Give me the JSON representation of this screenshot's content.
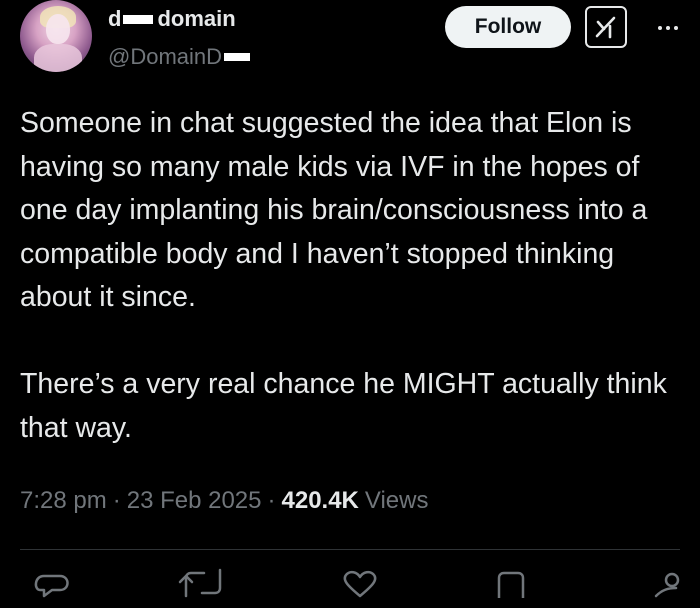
{
  "author": {
    "display_name_start": "d",
    "display_name_rest": "domain",
    "handle": "@DomainD"
  },
  "header": {
    "follow_label": "Follow",
    "grok_icon": "grok-icon",
    "more_icon": "more-icon"
  },
  "tweet": {
    "paragraphs": [
      "Someone in chat suggested the idea that Elon is having so many male kids via IVF in the hopes of one day implanting his brain/consciousness into a compatible body and I haven’t stopped thinking about it since.",
      "There’s a very real chance he MIGHT actually think that way."
    ]
  },
  "meta": {
    "time": "7:28 pm",
    "date": "23 Feb 2025",
    "separator": "·",
    "views_count": "420.4K",
    "views_label": "Views"
  },
  "actions": {
    "reply_icon": "reply-icon",
    "retweet_icon": "retweet-icon",
    "like_icon": "heart-icon",
    "bookmark_icon": "bookmark-icon",
    "share_icon": "share-icon"
  },
  "colors": {
    "background": "#000000",
    "text_primary": "#e7e9ea",
    "text_secondary": "#71767b",
    "follow_bg": "#eff3f4",
    "divider": "#2f3336"
  }
}
